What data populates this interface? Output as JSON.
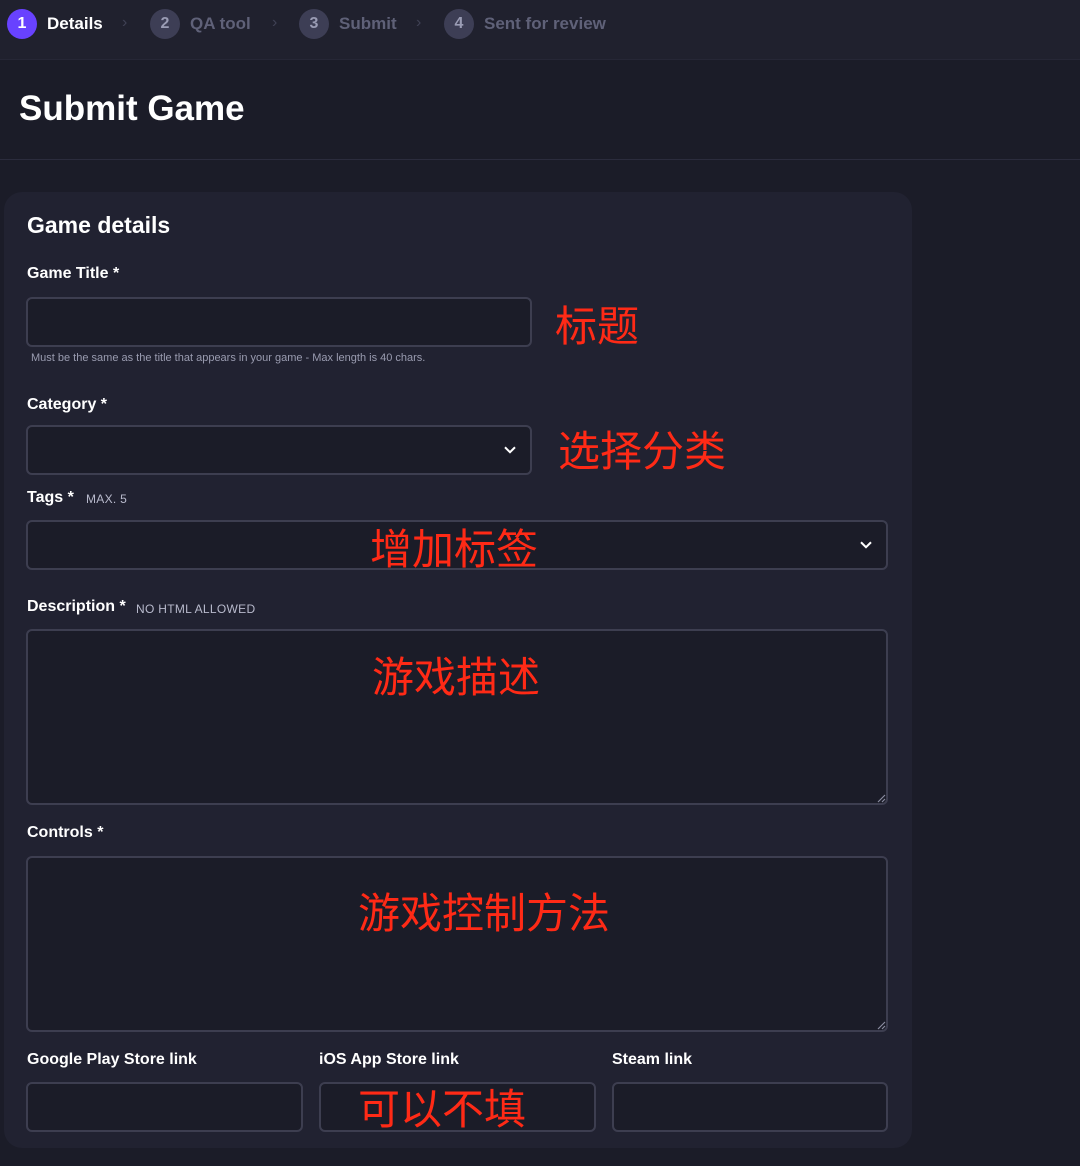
{
  "stepper": {
    "steps": [
      {
        "num": "1",
        "label": "Details",
        "active": true
      },
      {
        "num": "2",
        "label": "QA tool",
        "active": false
      },
      {
        "num": "3",
        "label": "Submit",
        "active": false
      },
      {
        "num": "4",
        "label": "Sent for review",
        "active": false
      }
    ],
    "chevron": "›"
  },
  "header": {
    "title": "Submit Game"
  },
  "form": {
    "section_title": "Game details",
    "game_title": {
      "label": "Game Title *",
      "value": "",
      "helper": "Must be the same as the title that appears in your game - Max length is 40 chars."
    },
    "category": {
      "label": "Category *",
      "value": ""
    },
    "tags": {
      "label": "Tags *",
      "note": "MAX. 5",
      "value": ""
    },
    "description": {
      "label": "Description *",
      "note": "NO HTML ALLOWED",
      "value": ""
    },
    "controls": {
      "label": "Controls *",
      "value": ""
    },
    "links": {
      "google_play": {
        "label": "Google Play Store link",
        "value": ""
      },
      "ios": {
        "label": "iOS App Store link",
        "value": ""
      },
      "steam": {
        "label": "Steam link",
        "value": ""
      }
    },
    "dropdown_icon": "chevron-down-icon"
  },
  "annotations": {
    "title": "标题",
    "category": "选择分类",
    "tags": "增加标签",
    "description": "游戏描述",
    "controls": "游戏控制方法",
    "links": "可以不填"
  },
  "colors": {
    "accent": "#6842ff",
    "background": "#1b1c28",
    "card": "#212231",
    "annotation": "#ff2a16"
  }
}
